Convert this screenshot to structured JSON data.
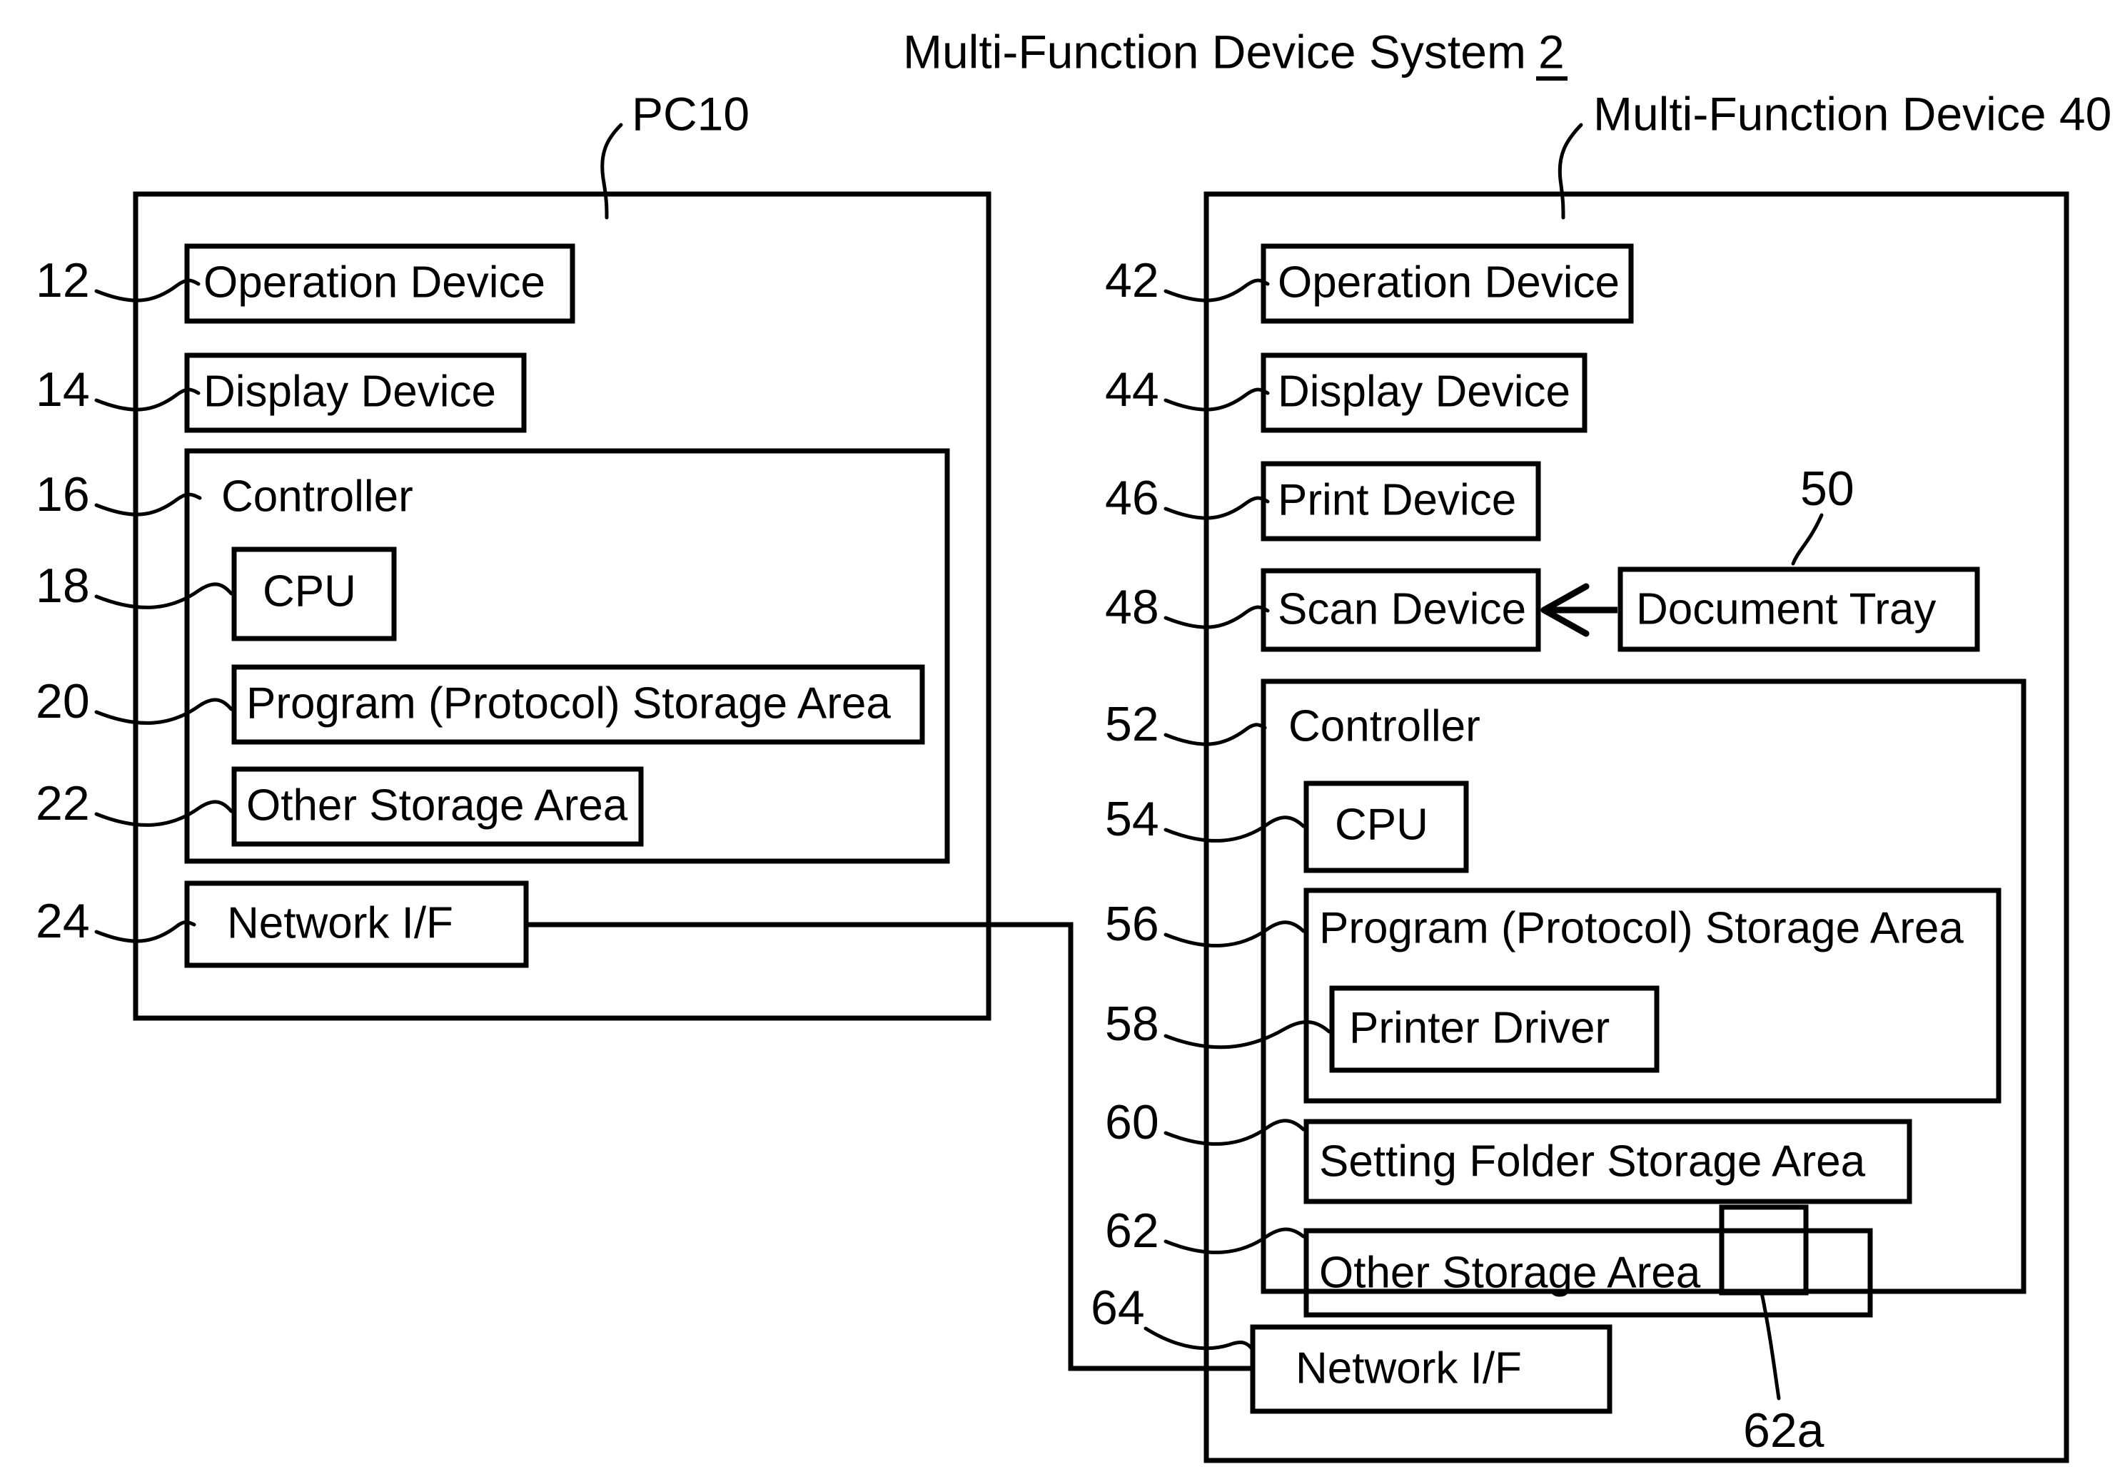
{
  "figure": {
    "title": "Multi-Function Device System",
    "title_number": "2",
    "title_number_underlined": true
  },
  "panels": {
    "pc": {
      "label": "PC10",
      "blocks": [
        {
          "ref": "12",
          "label": "Operation Device"
        },
        {
          "ref": "14",
          "label": "Display Device"
        },
        {
          "ref": "16",
          "label": "Controller"
        },
        {
          "ref": "18",
          "label": "CPU"
        },
        {
          "ref": "20",
          "label": "Program (Protocol) Storage Area"
        },
        {
          "ref": "22",
          "label": "Other Storage Area"
        },
        {
          "ref": "24",
          "label": "Network I/F"
        }
      ]
    },
    "mfd": {
      "label": "Multi-Function Device 40",
      "blocks": [
        {
          "ref": "42",
          "label": "Operation Device"
        },
        {
          "ref": "44",
          "label": "Display Device"
        },
        {
          "ref": "46",
          "label": "Print Device"
        },
        {
          "ref": "48",
          "label": "Scan Device"
        },
        {
          "ref": "50",
          "label": "Document Tray"
        },
        {
          "ref": "52",
          "label": "Controller"
        },
        {
          "ref": "54",
          "label": "CPU"
        },
        {
          "ref": "56",
          "label": "Program (Protocol) Storage Area"
        },
        {
          "ref": "58",
          "label": "Printer Driver"
        },
        {
          "ref": "60",
          "label": "Setting Folder Storage Area"
        },
        {
          "ref": "62",
          "label": "Other Storage Area"
        },
        {
          "ref": "62a",
          "label": ""
        },
        {
          "ref": "64",
          "label": "Network I/F"
        }
      ]
    }
  },
  "connections": {
    "document_tray_to_scan": "arrow-left",
    "pc_netif_to_mfd_netif": "network-link"
  },
  "colors": {
    "ink": "#000000",
    "paper": "#ffffff"
  }
}
